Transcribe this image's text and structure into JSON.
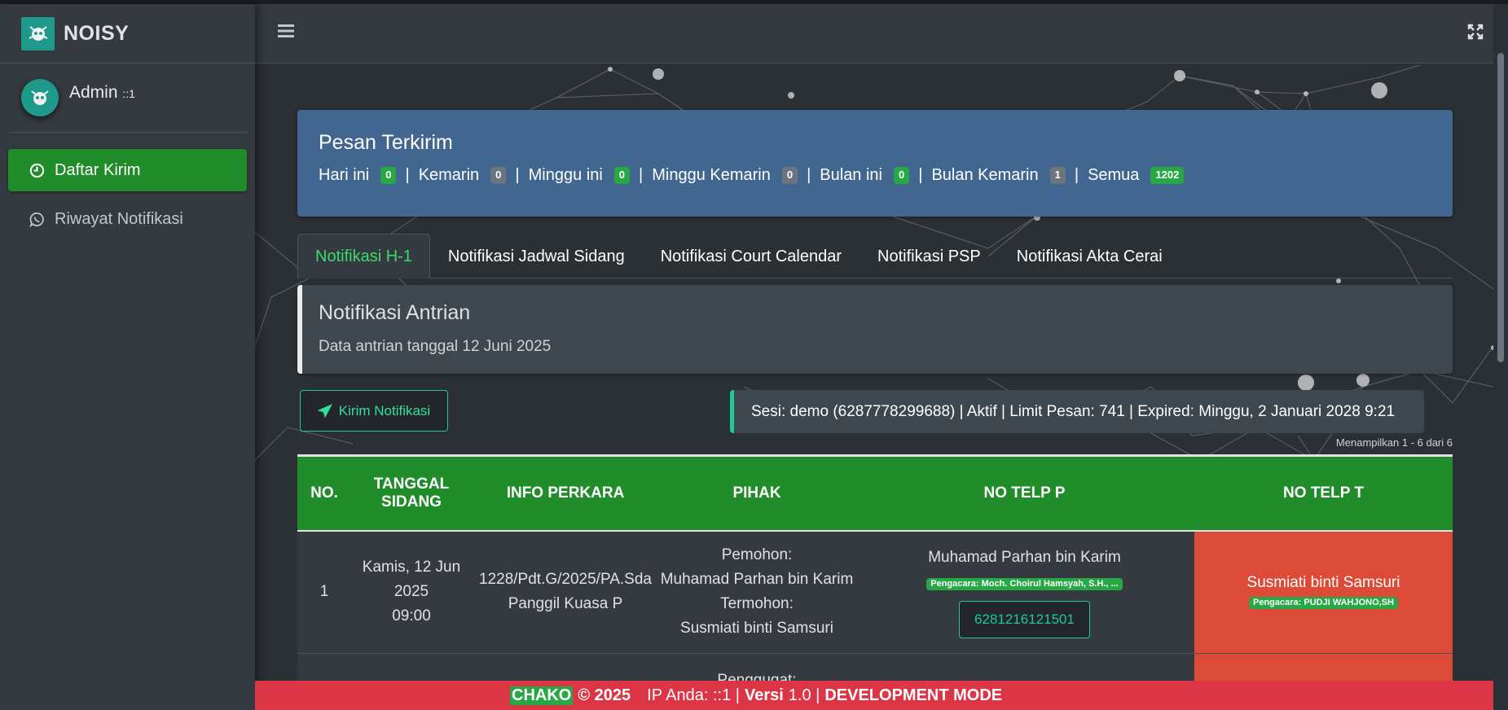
{
  "brand": {
    "name": "NOISY"
  },
  "user": {
    "name": "Admin",
    "suffix": "::1"
  },
  "sidebar": {
    "items": [
      {
        "label": "Daftar Kirim",
        "icon": "clock-icon",
        "active": true
      },
      {
        "label": "Riwayat Notifikasi",
        "icon": "whatsapp-icon",
        "active": false
      }
    ]
  },
  "summary": {
    "title": "Pesan Terkirim",
    "stats": [
      {
        "label": "Hari ini",
        "value": "0",
        "color": "green"
      },
      {
        "label": "Kemarin",
        "value": "0",
        "color": "gray"
      },
      {
        "label": "Minggu ini",
        "value": "0",
        "color": "green"
      },
      {
        "label": "Minggu Kemarin",
        "value": "0",
        "color": "gray"
      },
      {
        "label": "Bulan ini",
        "value": "0",
        "color": "green"
      },
      {
        "label": "Bulan Kemarin",
        "value": "1",
        "color": "gray"
      },
      {
        "label": "Semua",
        "value": "1202",
        "color": "green"
      }
    ]
  },
  "tabs": [
    {
      "label": "Notifikasi H-1",
      "active": true
    },
    {
      "label": "Notifikasi Jadwal Sidang",
      "active": false
    },
    {
      "label": "Notifikasi Court Calendar",
      "active": false
    },
    {
      "label": "Notifikasi PSP",
      "active": false
    },
    {
      "label": "Notifikasi Akta Cerai",
      "active": false
    }
  ],
  "callout": {
    "title": "Notifikasi Antrian",
    "text": "Data antrian tanggal 12 Juni 2025"
  },
  "actions": {
    "send_label": "Kirim Notifikasi",
    "session_text": "Sesi: demo (6287778299688) | Aktif | Limit Pesan: 741 | Expired: Minggu, 2 Januari 2028 9:21",
    "showing_text": "Menampilkan 1 - 6 dari 6"
  },
  "table": {
    "headers": {
      "no": "NO.",
      "tanggal_line1": "TANGGAL",
      "tanggal_line2": "SIDANG",
      "info": "INFO PERKARA",
      "pihak": "PIHAK",
      "telp_p": "NO TELP P",
      "telp_t": "NO TELP T"
    },
    "rows": [
      {
        "no": "1",
        "date": "Kamis, 12 Jun 2025",
        "time": "09:00",
        "case_no": "1228/Pdt.G/2025/PA.Sda",
        "case_note": "Panggil Kuasa P",
        "role_p": "Pemohon:",
        "name_p": "Muhamad Parhan bin Karim",
        "role_t": "Termohon:",
        "name_t": "Susmiati binti Samsuri",
        "telp_p_name": "Muhamad Parhan bin Karim",
        "telp_p_lawyer": "Pengacara: Moch. Choirul Hamsyah, S.H., ...",
        "telp_p_number": "6281216121501",
        "telp_t_name": "Susmiati binti Samsuri",
        "telp_t_lawyer": "Pengacara: PUDJI WAHJONO,SH"
      },
      {
        "role_p": "Penggugat:"
      }
    ]
  },
  "footer": {
    "brand": "CHAKO",
    "copyright": "© 2025",
    "ip_label": "IP Anda: ::1 |",
    "version_label": "Versi",
    "version_value": "1.0 |",
    "mode": "DEVELOPMENT MODE"
  },
  "colors": {
    "accent_green": "#218c2a",
    "summary_blue": "#41668f",
    "footer_red": "#dc3545",
    "cell_red": "#dc4a38"
  }
}
